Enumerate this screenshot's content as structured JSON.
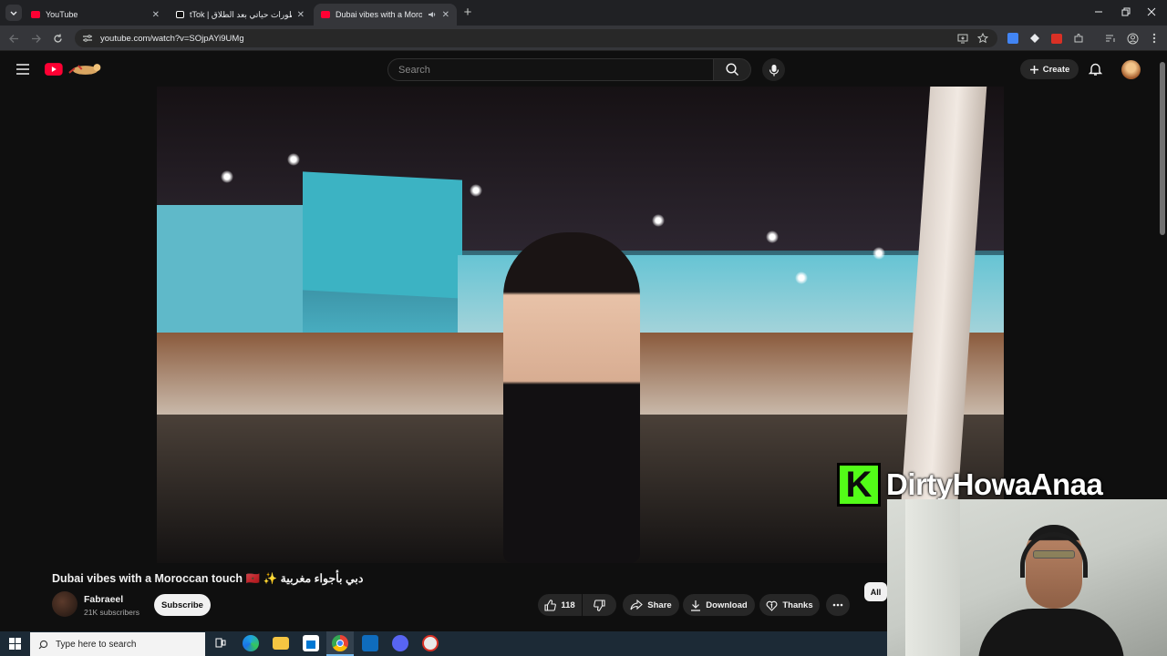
{
  "browser": {
    "tabs": [
      {
        "title": "YouTube",
        "active": false
      },
      {
        "title": "tTok | تطورات حياتي بعد الطلاق",
        "active": false
      },
      {
        "title": "Dubai vibes with a Moroccan",
        "active": true
      }
    ],
    "url": "youtube.com/watch?v=SOjpAYi9UMg"
  },
  "youtube": {
    "search_placeholder": "Search",
    "create_label": "Create"
  },
  "video": {
    "title": "Dubai vibes with a Moroccan touch 🇲🇦 ✨ دبي بأجواء مغربية",
    "channel": "Fabraeel",
    "subscribers": "21K subscribers",
    "subscribe_label": "Subscribe",
    "likes": "118",
    "share_label": "Share",
    "download_label": "Download",
    "thanks_label": "Thanks",
    "chip_all": "All"
  },
  "stream_overlay": {
    "kick_logo": "K",
    "streamer_name": "DirtyHowaAnaa"
  },
  "taskbar": {
    "search_placeholder": "Type here to search"
  },
  "colors": {
    "youtube_red": "#ff0033",
    "kick_green": "#53fc18"
  }
}
